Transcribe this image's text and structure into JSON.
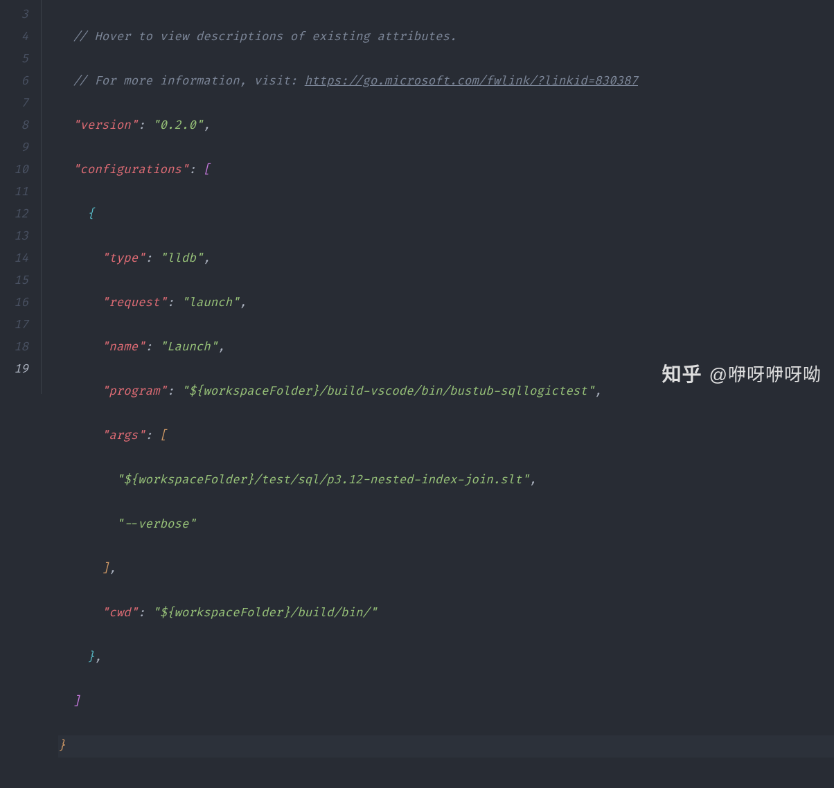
{
  "line_numbers": [
    "3",
    "4",
    "5",
    "6",
    "7",
    "8",
    "9",
    "10",
    "11",
    "12",
    "13",
    "14",
    "15",
    "16",
    "17",
    "18",
    "19"
  ],
  "active_line_index": 16,
  "comment1": "// Hover to view descriptions of existing attributes.",
  "comment2_prefix": "// For more information, visit: ",
  "comment2_link": "https://go.microsoft.com/fwlink/?linkid=830387",
  "k_version": "\"version\"",
  "v_version": "\"0.2.0\"",
  "k_configurations": "\"configurations\"",
  "k_type": "\"type\"",
  "v_type": "\"lldb\"",
  "k_request": "\"request\"",
  "v_request": "\"launch\"",
  "k_name": "\"name\"",
  "v_name": "\"Launch\"",
  "k_program": "\"program\"",
  "v_program": "\"${workspaceFolder}/build-vscode/bin/bustub-sqllogictest\"",
  "k_args": "\"args\"",
  "v_arg0": "\"${workspaceFolder}/test/sql/p3.12-nested-index-join.slt\"",
  "v_arg1": "\"--verbose\"",
  "k_cwd": "\"cwd\"",
  "v_cwd": "\"${workspaceFolder}/build/bin/\"",
  "p_colon": ": ",
  "p_comma": ",",
  "p_obracket": "[",
  "p_cbracket": "]",
  "p_obrace": "{",
  "p_cbrace": "}",
  "watermark_logo": "知乎",
  "watermark_text": "@咿呀咿呀呦"
}
